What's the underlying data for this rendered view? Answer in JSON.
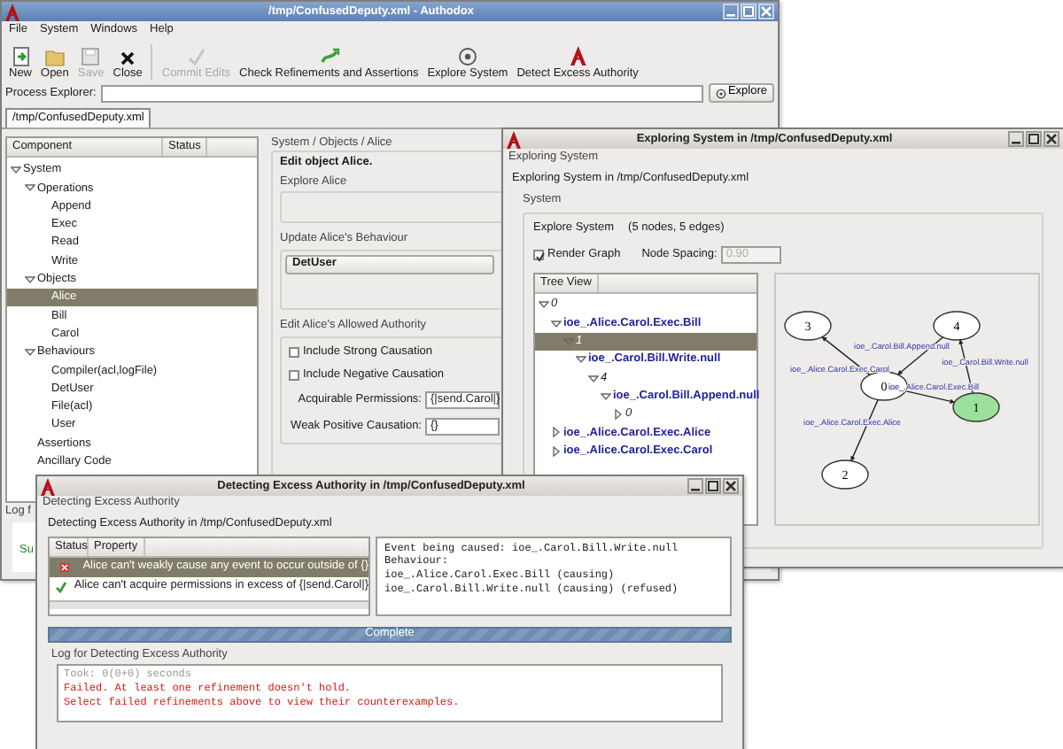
{
  "main_window": {
    "title": "/tmp/ConfusedDeputy.xml - Authodox",
    "menu": [
      "File",
      "System",
      "Windows",
      "Help"
    ],
    "toolbar": [
      {
        "label": "New",
        "kind": "new",
        "disabled": false
      },
      {
        "label": "Open",
        "kind": "open",
        "disabled": false
      },
      {
        "label": "Save",
        "kind": "save",
        "disabled": true
      },
      {
        "label": "Close",
        "kind": "close",
        "disabled": false
      },
      {
        "label": "Commit Edits",
        "kind": "commit",
        "disabled": true
      },
      {
        "label": "Check Refinements and Assertions",
        "kind": "check",
        "disabled": false
      },
      {
        "label": "Explore System",
        "kind": "explore",
        "disabled": false
      },
      {
        "label": "Detect Excess Authority",
        "kind": "detect",
        "disabled": false
      }
    ],
    "process_explorer": {
      "label": "Process Explorer:",
      "button": "Explore"
    },
    "tabs": [
      {
        "label": "/tmp/ConfusedDeputy.xml",
        "selected": true
      }
    ],
    "component_tree": {
      "columns": [
        "Component",
        "Status"
      ],
      "items": [
        {
          "label": "System",
          "selected": false,
          "expanded": true,
          "children": [
            {
              "label": "Operations",
              "selected": false,
              "expanded": true,
              "children": [
                {
                  "label": "Append",
                  "selected": false
                },
                {
                  "label": "Exec",
                  "selected": false
                },
                {
                  "label": "Read",
                  "selected": false
                },
                {
                  "label": "Write",
                  "selected": false
                }
              ]
            },
            {
              "label": "Objects",
              "selected": false,
              "expanded": true,
              "children": [
                {
                  "label": "Alice",
                  "selected": true
                },
                {
                  "label": "Bill",
                  "selected": false
                },
                {
                  "label": "Carol",
                  "selected": false
                }
              ]
            },
            {
              "label": "Behaviours",
              "selected": false,
              "expanded": true,
              "children": [
                {
                  "label": "Compiler(acl,logFile)",
                  "selected": false
                },
                {
                  "label": "DetUser",
                  "selected": false
                },
                {
                  "label": "File(acl)",
                  "selected": false
                },
                {
                  "label": "User",
                  "selected": false
                }
              ]
            },
            {
              "label": "Assertions",
              "selected": false
            },
            {
              "label": "Ancillary Code",
              "selected": false
            }
          ]
        }
      ]
    },
    "editor": {
      "breadcrumb": "System / Objects / Alice",
      "heading": "Edit object Alice.",
      "explore_group": "Explore Alice",
      "behaviour_group": {
        "title": "Update Alice's Behaviour",
        "value": "DetUser"
      },
      "authority_group": {
        "title": "Edit Alice's Allowed Authority",
        "checkboxes": [
          {
            "label": "Include Strong Causation",
            "checked": false
          },
          {
            "label": "Include Negative Causation",
            "checked": false
          }
        ],
        "fields": [
          {
            "label": "Acquirable Permissions:",
            "value": "{|send.Carol|}"
          },
          {
            "label": "Weak Positive Causation:",
            "value": "{}"
          }
        ]
      }
    },
    "log": {
      "title": "Log f",
      "line": "Su"
    }
  },
  "explore_window": {
    "title": "Exploring System in /tmp/ConfusedDeputy.xml",
    "group": "Exploring System",
    "heading": "Exploring System in /tmp/ConfusedDeputy.xml",
    "system_group": "System",
    "summary": "Explore System",
    "counts": "(5 nodes, 5 edges)",
    "render_graph": {
      "label": "Render Graph",
      "checked": true
    },
    "node_spacing": {
      "label": "Node Spacing:",
      "value": "0.90",
      "disabled": true
    },
    "tree_view": {
      "title": "Tree View",
      "items": [
        {
          "label": "0",
          "kind": "state",
          "selected": false,
          "expanded": true,
          "children": [
            {
              "label": "ioe_.Alice.Carol.Exec.Bill",
              "kind": "event",
              "selected": false,
              "expanded": true,
              "children": [
                {
                  "label": "1",
                  "kind": "state",
                  "selected": true,
                  "expanded": true,
                  "children": [
                    {
                      "label": "ioe_.Carol.Bill.Write.null",
                      "kind": "event",
                      "selected": false,
                      "expanded": true,
                      "children": [
                        {
                          "label": "4",
                          "kind": "state",
                          "selected": false,
                          "expanded": true,
                          "children": [
                            {
                              "label": "ioe_.Carol.Bill.Append.null",
                              "kind": "event",
                              "selected": false,
                              "expanded": true,
                              "children": [
                                {
                                  "label": "0",
                                  "kind": "state",
                                  "selected": false,
                                  "expanded": false
                                }
                              ]
                            }
                          ]
                        }
                      ]
                    }
                  ]
                }
              ]
            },
            {
              "label": "ioe_.Alice.Carol.Exec.Alice",
              "kind": "event",
              "selected": false,
              "expanded": false
            },
            {
              "label": "ioe_.Alice.Carol.Exec.Carol",
              "kind": "event",
              "selected": false,
              "expanded": false
            }
          ]
        }
      ]
    },
    "graph": {
      "nodes": [
        {
          "label": "0",
          "color": "#ffffff"
        },
        {
          "label": "1",
          "color": "#9be09b"
        },
        {
          "label": "2",
          "color": "#ffffff"
        },
        {
          "label": "3",
          "color": "#ffffff"
        },
        {
          "label": "4",
          "color": "#ffffff"
        }
      ],
      "edges": [
        {
          "label": "ioe_.Alice.Carol.Exec.Carol"
        },
        {
          "label": "ioe_.Carol.Bill.Append.null"
        },
        {
          "label": "ioe_.Alice.Carol.Exec.Bill"
        },
        {
          "label": "ioe_.Carol.Bill.Write.null"
        },
        {
          "label": "ioe_.Alice.Carol.Exec.Alice"
        }
      ]
    }
  },
  "detect_window": {
    "title": "Detecting Excess Authority in /tmp/ConfusedDeputy.xml",
    "group": "Detecting Excess Authority",
    "heading": "Detecting Excess Authority in /tmp/ConfusedDeputy.xml",
    "results": {
      "columns": [
        "Status",
        "Property"
      ],
      "rows": [
        {
          "kind": "failed",
          "property": "Alice can't weakly cause any event to occur outside of {}",
          "selected": true
        },
        {
          "kind": "passed",
          "property": "Alice can't acquire permissions in excess of {|send.Carol|}",
          "selected": false
        }
      ]
    },
    "details": [
      "Event being caused: ioe_.Carol.Bill.Write.null",
      "Behaviour:",
      "ioe_.Alice.Carol.Exec.Bill (causing)",
      "ioe_.Carol.Bill.Write.null (causing) (refused)"
    ],
    "progress": {
      "label": "Complete",
      "level": 1
    },
    "log": {
      "title": "Log for Detecting Excess Authority",
      "lines": [
        {
          "text": "Took: 0(0+0) seconds",
          "kind": "info"
        },
        {
          "text": "Failed. At least one refinement doesn't hold.",
          "kind": "error"
        },
        {
          "text": "Select failed refinements above to view their counterexamples.",
          "kind": "error"
        }
      ]
    }
  }
}
